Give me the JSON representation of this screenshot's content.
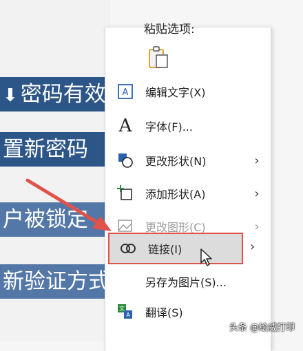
{
  "slide": {
    "rows": [
      {
        "text": "密码有效"
      },
      {
        "text": "置新密码"
      },
      {
        "text": "户被锁定"
      },
      {
        "text": "新验证方式"
      }
    ]
  },
  "menu": {
    "paste_title": "粘贴选项:",
    "items": [
      {
        "label": "编辑文字(X)",
        "icon": "edit-text-icon",
        "submenu": false,
        "enabled": true
      },
      {
        "label": "字体(F)...",
        "icon": "font-icon",
        "submenu": false,
        "enabled": true
      },
      {
        "label": "更改形状(N)",
        "icon": "change-shape-icon",
        "submenu": true,
        "enabled": true
      },
      {
        "label": "添加形状(A)",
        "icon": "add-shape-icon",
        "submenu": true,
        "enabled": true
      },
      {
        "label": "更改图形(C)",
        "icon": "change-graphic-icon",
        "submenu": true,
        "enabled": false
      },
      {
        "label": "链接(I)",
        "icon": "link-icon",
        "submenu": true,
        "enabled": true,
        "highlighted": true
      },
      {
        "label": "另存为图片(S)...",
        "icon": "",
        "submenu": false,
        "enabled": true
      },
      {
        "label": "翻译(S)",
        "icon": "translate-icon",
        "submenu": false,
        "enabled": true
      }
    ]
  },
  "watermark": "头条 @绘威打印",
  "colors": {
    "highlight_border": "#e0524a",
    "arrow": "#e0524a",
    "bar": "#2c5588"
  }
}
